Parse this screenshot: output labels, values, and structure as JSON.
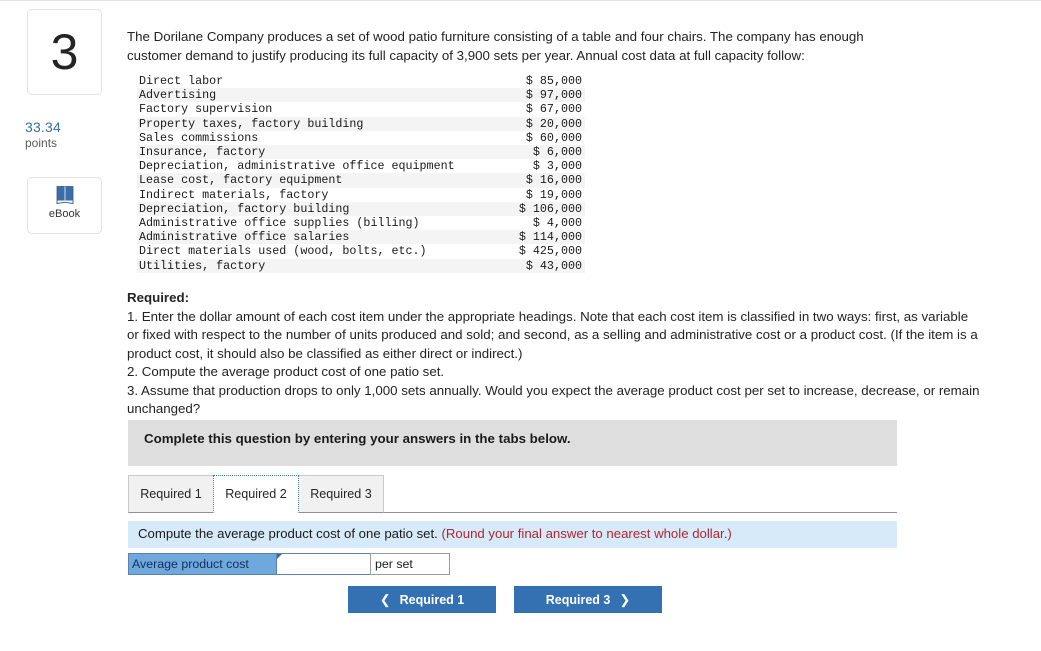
{
  "question": {
    "number": "3",
    "points_value": "33.34",
    "points_label": "points",
    "ebook_label": "eBook",
    "ebook_icon": "book-icon"
  },
  "intro": {
    "text": "The Dorilane Company produces a set of wood patio furniture consisting of a table and four chairs. The company has enough customer demand to justify producing its full capacity of 3,900 sets per year. Annual cost data at full capacity follow:"
  },
  "cost_table": {
    "rows": [
      {
        "item": "Direct labor",
        "amount": "$ 85,000"
      },
      {
        "item": "Advertising",
        "amount": "$ 97,000"
      },
      {
        "item": "Factory supervision",
        "amount": "$ 67,000"
      },
      {
        "item": "Property taxes, factory building",
        "amount": "$ 20,000"
      },
      {
        "item": "Sales commissions",
        "amount": "$ 60,000"
      },
      {
        "item": "Insurance, factory",
        "amount": "$ 6,000"
      },
      {
        "item": "Depreciation, administrative office equipment",
        "amount": "$ 3,000"
      },
      {
        "item": "Lease cost, factory equipment",
        "amount": "$ 16,000"
      },
      {
        "item": "Indirect materials, factory",
        "amount": "$ 19,000"
      },
      {
        "item": "Depreciation, factory building",
        "amount": "$ 106,000"
      },
      {
        "item": "Administrative office supplies (billing)",
        "amount": "$ 4,000"
      },
      {
        "item": "Administrative office salaries",
        "amount": "$ 114,000"
      },
      {
        "item": "Direct materials used (wood, bolts, etc.)",
        "amount": "$ 425,000"
      },
      {
        "item": "Utilities, factory",
        "amount": "$ 43,000"
      }
    ]
  },
  "required": {
    "heading": "Required:",
    "items": [
      "1. Enter the dollar amount of each cost item under the appropriate headings. Note that each cost item is classified in two ways: first, as variable or fixed with respect to the number of units produced and sold; and second, as a selling and administrative cost or a product cost. (If the item is a product cost, it should also be classified as either direct or indirect.)",
      "2. Compute the average product cost of one patio set.",
      "3. Assume that production drops to only 1,000 sets annually. Would you expect the average product cost per set to increase, decrease, or remain unchanged?"
    ]
  },
  "answer_area": {
    "banner_text": "Complete this question by entering your answers in the tabs below.",
    "tabs": [
      {
        "label": "Required 1",
        "active": false
      },
      {
        "label": "Required 2",
        "active": true
      },
      {
        "label": "Required 3",
        "active": false
      }
    ],
    "instruction": "Compute the average product cost of one patio set. ",
    "instruction_note": "(Round your final answer to nearest whole dollar.)",
    "answer_label": "Average product cost",
    "answer_value": "",
    "answer_placeholder": "",
    "answer_unit": "per set"
  },
  "navigation": {
    "prev_label": "Required 1",
    "next_label": "Required 3",
    "prev_icon": "chevron-left-icon",
    "next_icon": "chevron-right-icon"
  },
  "colors": {
    "accent_blue": "#3371b2",
    "label_blue": "#6fa8dc",
    "instruction_bg": "#d7eafa",
    "banner_gray": "#dededf",
    "note_red": "#b2262f",
    "points_blue": "#3b6ea5"
  }
}
